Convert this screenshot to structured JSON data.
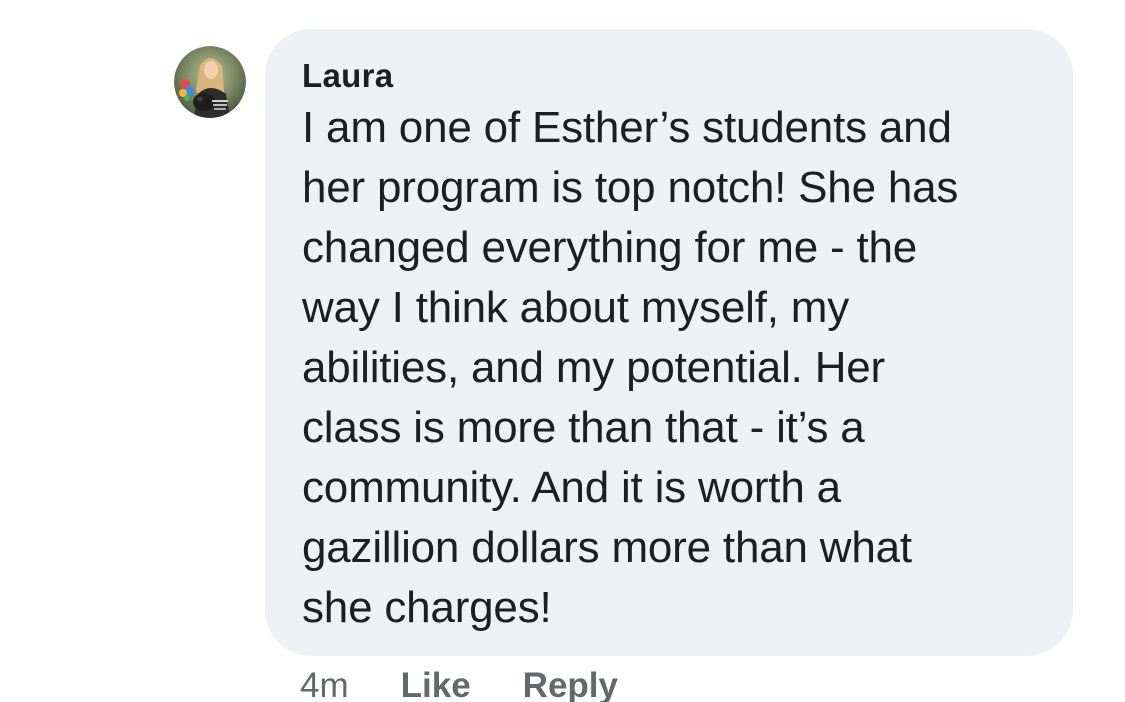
{
  "comment": {
    "author": "Laura",
    "avatar_icon": "profile-photo",
    "text": "I am one of Esther’s students and\nher program is top notch! She has\nchanged everything for me - the\nway I think about myself, my\nabilities, and my potential. Her\nclass is more than that - it’s a\ncommunity. And it is worth a\ngazillion dollars more than what\nshe charges!",
    "timestamp": "4m",
    "like_label": "Like",
    "reply_label": "Reply"
  },
  "colors": {
    "bubble_bg": "#eef0f3",
    "text": "#1c1e21",
    "meta": "#65676b"
  }
}
